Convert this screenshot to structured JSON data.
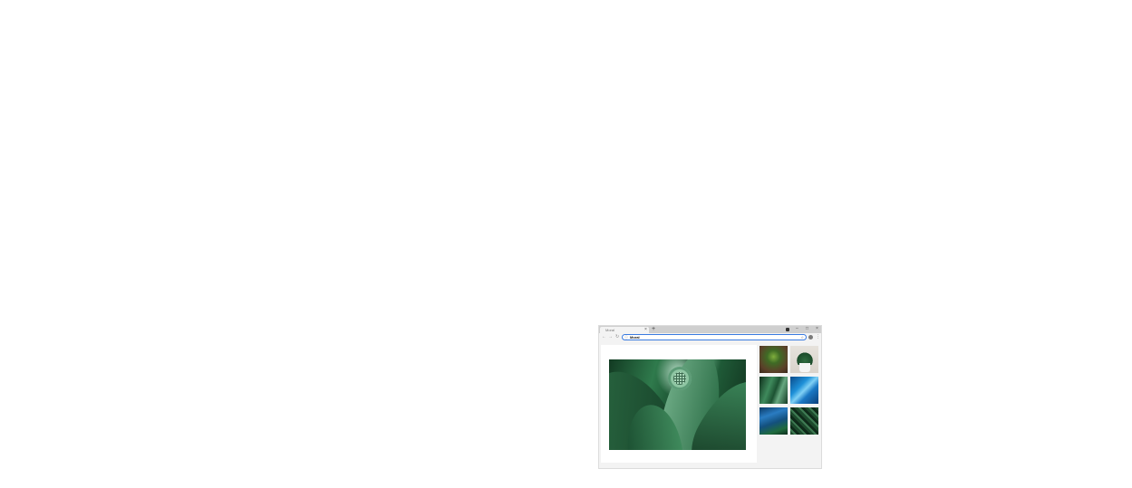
{
  "browser": {
    "tab": {
      "title": "Moral",
      "close_glyph": "×"
    },
    "new_tab_glyph": "+",
    "window_controls": {
      "minimize": "–",
      "maximize": "□",
      "close": "×"
    },
    "nav": {
      "back": "←",
      "forward": "→",
      "reload": "↻"
    },
    "omnibox": {
      "icon": "ⓘ",
      "value": "Moral",
      "star": "☆"
    },
    "menu_glyph": "⋮"
  },
  "page": {
    "hero_image": {
      "alt_icon": "image-icon"
    },
    "thumbnails": [
      {
        "name": "seedling"
      },
      {
        "name": "potted-succulent"
      },
      {
        "name": "green-leaves"
      },
      {
        "name": "blue-leaves"
      },
      {
        "name": "blue-green-foliage"
      },
      {
        "name": "dark-foliage"
      }
    ]
  }
}
